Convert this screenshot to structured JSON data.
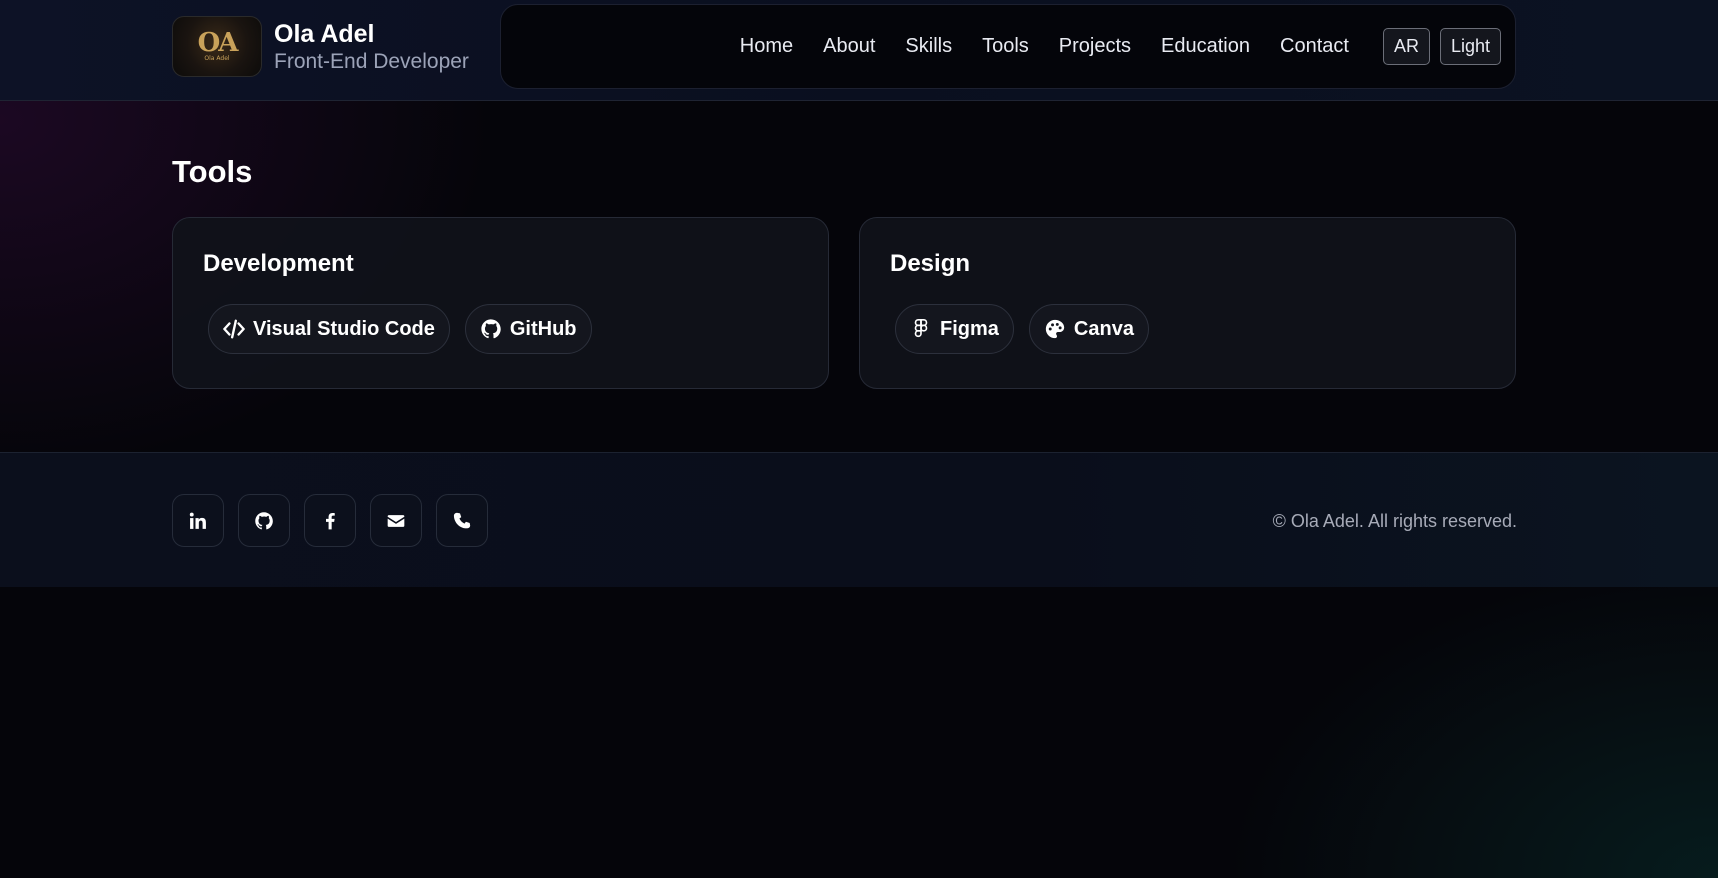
{
  "brand": {
    "name": "Ola Adel",
    "role": "Front-End Developer",
    "logo_text": "OA",
    "logo_subtext": "Ola Adel"
  },
  "nav": {
    "links": [
      "Home",
      "About",
      "Skills",
      "Tools",
      "Projects",
      "Education",
      "Contact"
    ],
    "lang_button": "AR",
    "theme_button": "Light"
  },
  "tools": {
    "title": "Tools",
    "development": {
      "title": "Development",
      "items": [
        {
          "label": "Visual Studio Code",
          "icon": "code-icon"
        },
        {
          "label": "GitHub",
          "icon": "github-icon"
        }
      ]
    },
    "design": {
      "title": "Design",
      "items": [
        {
          "label": "Figma",
          "icon": "figma-icon"
        },
        {
          "label": "Canva",
          "icon": "palette-icon"
        }
      ]
    }
  },
  "footer": {
    "socials": [
      "linkedin-icon",
      "github-icon",
      "facebook-icon",
      "envelope-icon",
      "phone-icon"
    ],
    "copyright": "© Ola Adel. All rights reserved."
  },
  "colors": {
    "background": "#05050a",
    "card": "#10121a",
    "accent_gold": "#c9a25a",
    "muted_text": "#9ca3b8"
  }
}
